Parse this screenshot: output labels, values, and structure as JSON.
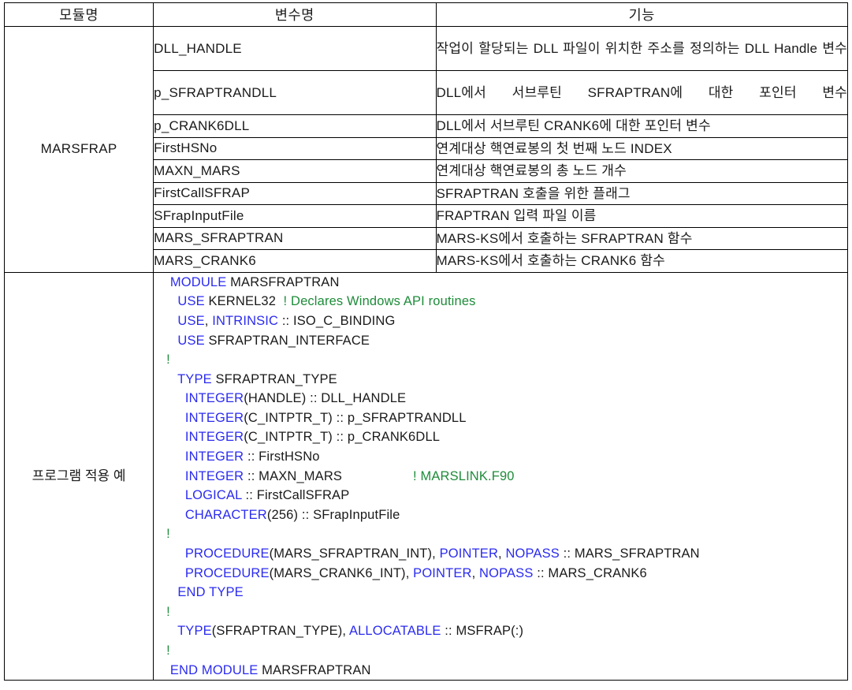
{
  "table": {
    "headers": {
      "module": "모듈명",
      "variable": "변수명",
      "function": "기능"
    },
    "groups": [
      {
        "module_label": "MARSFRAP",
        "rows": [
          {
            "variable": "DLL_HANDLE",
            "function": "작업이 할당되는 DLL 파일이 위치한 주소를 정의하는 DLL Handle 변수",
            "lines": 2
          },
          {
            "variable": "p_SFRAPTRANDLL",
            "function": "DLL에서 서브루틴 SFRAPTRAN에 대한 포인터 변수",
            "lines": 2
          },
          {
            "variable": "p_CRANK6DLL",
            "function": "DLL에서 서브루틴 CRANK6에 대한 포인터 변수",
            "lines": 1
          },
          {
            "variable": "FirstHSNo",
            "function": "연계대상 핵연료봉의 첫 번째 노드 INDEX",
            "lines": 1
          },
          {
            "variable": "MAXN_MARS",
            "function": "연계대상 핵연료봉의 총 노드 개수",
            "lines": 1
          },
          {
            "variable": "FirstCallSFRAP",
            "function": "SFRAPTRAN 호출을 위한 플래그",
            "lines": 1
          },
          {
            "variable": "SFrapInputFile",
            "function": "FRAPTRAN 입력 파일 이름",
            "lines": 1
          },
          {
            "variable": "MARS_SFRAPTRAN",
            "function": "MARS-KS에서 호출하는 SFRAPTRAN 함수",
            "lines": 1
          },
          {
            "variable": "MARS_CRANK6",
            "function": "MARS-KS에서 호출하는 CRANK6 함수",
            "lines": 1
          }
        ]
      }
    ],
    "code_section": {
      "label": "프로그램 적용 예",
      "language": "fortran",
      "listing": [
        {
          "indent": 1,
          "tokens": [
            {
              "t": "kw",
              "s": "MODULE"
            },
            {
              "t": "pl",
              "s": " MARSFRAPTRAN"
            }
          ]
        },
        {
          "indent": 3,
          "tokens": [
            {
              "t": "kw",
              "s": "USE"
            },
            {
              "t": "pl",
              "s": " KERNEL32  "
            },
            {
              "t": "cm",
              "s": "! Declares Windows API routines"
            }
          ]
        },
        {
          "indent": 3,
          "tokens": [
            {
              "t": "kw",
              "s": "USE"
            },
            {
              "t": "pl",
              "s": ", "
            },
            {
              "t": "kw",
              "s": "INTRINSIC"
            },
            {
              "t": "pl",
              "s": " :: ISO_C_BINDING"
            }
          ]
        },
        {
          "indent": 3,
          "tokens": [
            {
              "t": "kw",
              "s": "USE"
            },
            {
              "t": "pl",
              "s": " SFRAPTRAN_INTERFACE"
            }
          ]
        },
        {
          "indent": 0,
          "tokens": [
            {
              "t": "cm",
              "s": "!"
            }
          ]
        },
        {
          "indent": 3,
          "tokens": [
            {
              "t": "kw",
              "s": "TYPE"
            },
            {
              "t": "pl",
              "s": " SFRAPTRAN_TYPE"
            }
          ]
        },
        {
          "indent": 5,
          "tokens": [
            {
              "t": "kw",
              "s": "INTEGER"
            },
            {
              "t": "pl",
              "s": "(HANDLE) :: DLL_HANDLE"
            }
          ]
        },
        {
          "indent": 5,
          "tokens": [
            {
              "t": "kw",
              "s": "INTEGER"
            },
            {
              "t": "pl",
              "s": "(C_INTPTR_T) :: p_SFRAPTRANDLL"
            }
          ]
        },
        {
          "indent": 5,
          "tokens": [
            {
              "t": "kw",
              "s": "INTEGER"
            },
            {
              "t": "pl",
              "s": "(C_INTPTR_T) :: p_CRANK6DLL"
            }
          ]
        },
        {
          "indent": 5,
          "tokens": [
            {
              "t": "kw",
              "s": "INTEGER"
            },
            {
              "t": "pl",
              "s": " :: FirstHSNo"
            }
          ]
        },
        {
          "indent": 5,
          "tokens": [
            {
              "t": "kw",
              "s": "INTEGER"
            },
            {
              "t": "pl",
              "s": " :: MAXN_MARS                   "
            },
            {
              "t": "cm",
              "s": "! MARSLINK.F90"
            }
          ]
        },
        {
          "indent": 5,
          "tokens": [
            {
              "t": "kw",
              "s": "LOGICAL"
            },
            {
              "t": "pl",
              "s": " :: FirstCallSFRAP"
            }
          ]
        },
        {
          "indent": 5,
          "tokens": [
            {
              "t": "kw",
              "s": "CHARACTER"
            },
            {
              "t": "pl",
              "s": "(256) :: SFrapInputFile"
            }
          ]
        },
        {
          "indent": 0,
          "tokens": [
            {
              "t": "cm",
              "s": "!"
            }
          ]
        },
        {
          "indent": 5,
          "tokens": [
            {
              "t": "kw",
              "s": "PROCEDURE"
            },
            {
              "t": "pl",
              "s": "(MARS_SFRAPTRAN_INT), "
            },
            {
              "t": "kw",
              "s": "POINTER"
            },
            {
              "t": "pl",
              "s": ", "
            },
            {
              "t": "kw",
              "s": "NOPASS"
            },
            {
              "t": "pl",
              "s": " :: MARS_SFRAPTRAN"
            }
          ]
        },
        {
          "indent": 5,
          "tokens": [
            {
              "t": "kw",
              "s": "PROCEDURE"
            },
            {
              "t": "pl",
              "s": "(MARS_CRANK6_INT), "
            },
            {
              "t": "kw",
              "s": "POINTER"
            },
            {
              "t": "pl",
              "s": ", "
            },
            {
              "t": "kw",
              "s": "NOPASS"
            },
            {
              "t": "pl",
              "s": " :: MARS_CRANK6"
            }
          ]
        },
        {
          "indent": 3,
          "tokens": [
            {
              "t": "kw",
              "s": "END TYPE"
            }
          ]
        },
        {
          "indent": 0,
          "tokens": [
            {
              "t": "cm",
              "s": "!"
            }
          ]
        },
        {
          "indent": 3,
          "tokens": [
            {
              "t": "kw",
              "s": "TYPE"
            },
            {
              "t": "pl",
              "s": "(SFRAPTRAN_TYPE), "
            },
            {
              "t": "kw",
              "s": "ALLOCATABLE"
            },
            {
              "t": "pl",
              "s": " :: MSFRAP(:)"
            }
          ]
        },
        {
          "indent": 0,
          "tokens": [
            {
              "t": "cm",
              "s": "!"
            }
          ]
        },
        {
          "indent": 1,
          "tokens": [
            {
              "t": "kw",
              "s": "END MODULE"
            },
            {
              "t": "pl",
              "s": " MARSFRAPTRAN"
            }
          ]
        }
      ]
    }
  },
  "colors": {
    "keyword": "#2b2bf0",
    "comment": "#1e8c3a",
    "text": "#1a1a1a",
    "border": "#000000"
  }
}
